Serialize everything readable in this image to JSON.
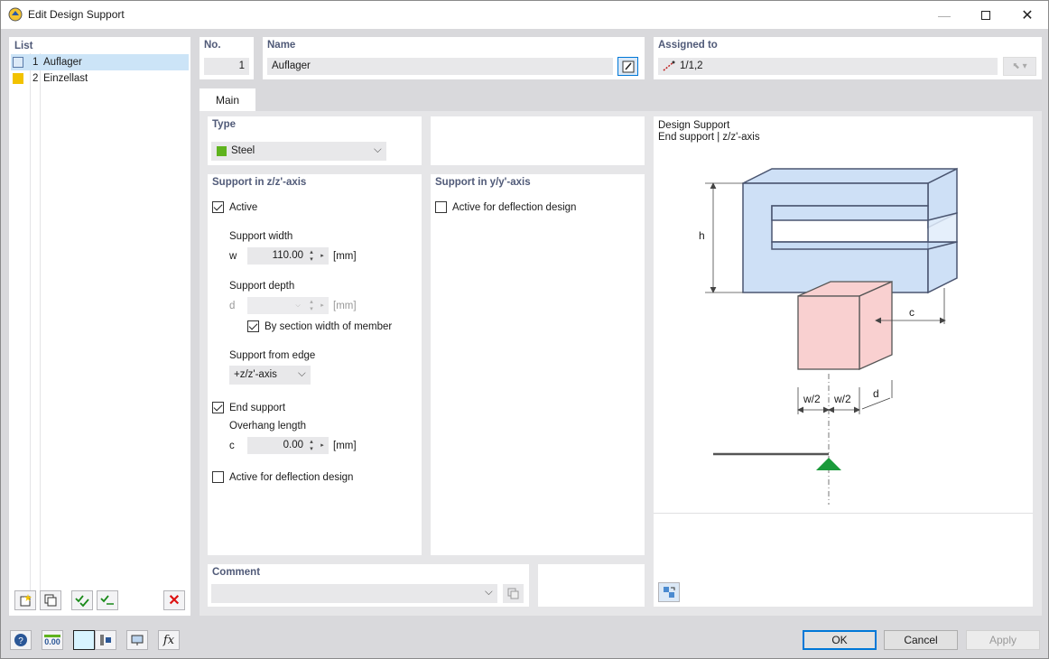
{
  "window": {
    "title": "Edit Design Support"
  },
  "list": {
    "header": "List",
    "items": [
      {
        "num": "1",
        "name": "Auflager",
        "color": "#dceaf7",
        "selected": true
      },
      {
        "num": "2",
        "name": "Einzellast",
        "color": "#f2c200",
        "selected": false
      }
    ]
  },
  "no": {
    "label": "No.",
    "value": "1"
  },
  "name": {
    "label": "Name",
    "value": "Auflager"
  },
  "assigned": {
    "label": "Assigned to",
    "value": "1/1,2"
  },
  "tabs": [
    {
      "label": "Main",
      "active": true
    }
  ],
  "type": {
    "label": "Type",
    "value": "Steel",
    "color": "#5fb31e"
  },
  "support_z": {
    "header": "Support in z/z'-axis",
    "active_label": "Active",
    "width_label": "Support width",
    "width_symbol": "w",
    "width_value": "110.00",
    "width_unit": "[mm]",
    "depth_label": "Support depth",
    "depth_symbol": "d",
    "depth_unit": "[mm]",
    "by_section_label": "By section width of member",
    "from_edge_label": "Support from edge",
    "from_edge_value": "+z/z'-axis",
    "end_support_label": "End support",
    "overhang_label": "Overhang length",
    "overhang_symbol": "c",
    "overhang_value": "0.00",
    "overhang_unit": "[mm]",
    "deflection_label": "Active for deflection design"
  },
  "support_y": {
    "header": "Support in y/y'-axis",
    "deflection_label": "Active for deflection design"
  },
  "comment": {
    "label": "Comment",
    "value": ""
  },
  "diagram": {
    "title": "Design Support",
    "subtitle": "End support | z/z'-axis",
    "label_h": "h",
    "label_c": "c",
    "label_w2a": "w/2",
    "label_w2b": "w/2",
    "label_d": "d"
  },
  "buttons": {
    "ok": "OK",
    "cancel": "Cancel",
    "apply": "Apply"
  },
  "bottom_icons": {
    "num_readout": "0.00"
  },
  "colors": {
    "accent": "#0078d7",
    "section_fill": "#c5daf5",
    "support_fill": "#f9d0d0",
    "triangle": "#1a9a3a"
  }
}
